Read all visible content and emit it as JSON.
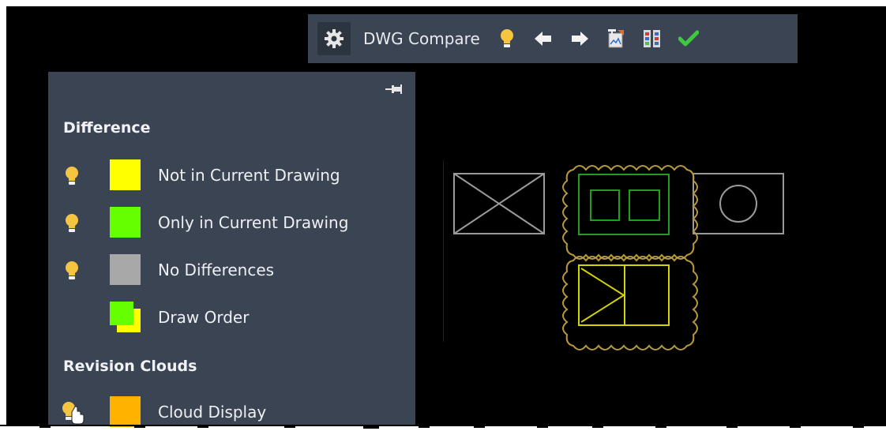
{
  "toolbar": {
    "title": "DWG Compare",
    "icons": [
      "settings-gear-icon",
      "lightbulb-icon",
      "arrow-left-icon",
      "arrow-right-icon",
      "export-snapshot-icon",
      "compare-overlay-icon",
      "checkmark-icon"
    ]
  },
  "panel": {
    "pin_icon": "pin-icon",
    "difference_heading": "Difference",
    "revision_heading": "Revision Clouds",
    "rows": [
      {
        "label": "Not in Current Drawing",
        "color": "#ffff00",
        "bulb": true
      },
      {
        "label": "Only in Current Drawing",
        "color": "#66ff00",
        "bulb": true
      },
      {
        "label": "No Differences",
        "color": "#a8a8a8",
        "bulb": true
      },
      {
        "label": "Draw Order",
        "color": "#66ff00",
        "color_back": "#ffff00",
        "bulb": false
      }
    ],
    "cloud_row": {
      "label": "Cloud Display",
      "color": "#ffb300"
    }
  },
  "colors": {
    "bulb": "#f5c542",
    "check": "#3ec93e",
    "cloud": "#b8993c",
    "green_geom": "#1f9e1f",
    "yellow_geom": "#d4d400",
    "gray_geom": "#9a9a9a"
  }
}
